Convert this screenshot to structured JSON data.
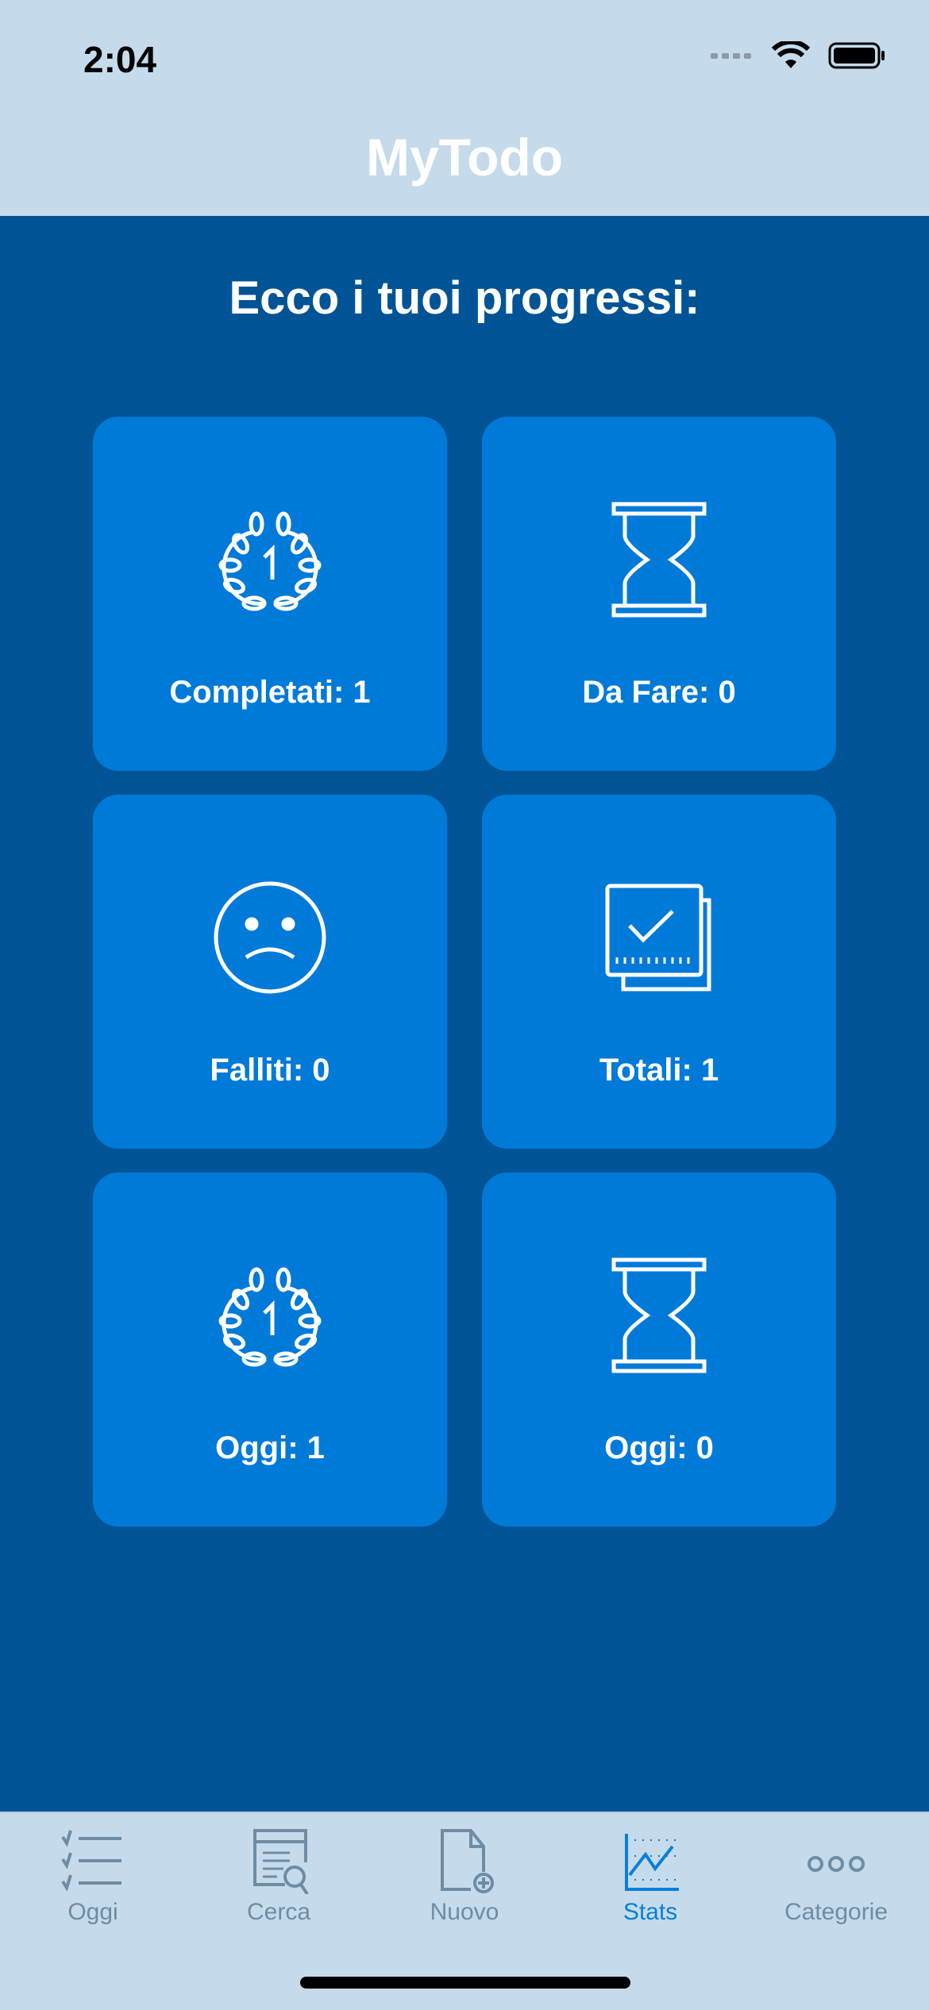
{
  "status_bar": {
    "time": "2:04"
  },
  "header": {
    "title": "MyTodo"
  },
  "main": {
    "heading": "Ecco i tuoi progressi:",
    "cards": [
      {
        "icon": "laurel-icon",
        "label": "Completati: 1"
      },
      {
        "icon": "hourglass-icon",
        "label": "Da Fare: 0"
      },
      {
        "icon": "sad-face-icon",
        "label": "Falliti: 0"
      },
      {
        "icon": "checked-docs-icon",
        "label": "Totali: 1"
      },
      {
        "icon": "laurel-icon",
        "label": "Oggi: 1"
      },
      {
        "icon": "hourglass-icon",
        "label": "Oggi: 0"
      }
    ]
  },
  "tabbar": {
    "items": [
      {
        "label": "Oggi",
        "icon": "checklist-icon"
      },
      {
        "label": "Cerca",
        "icon": "search-doc-icon"
      },
      {
        "label": "Nuovo",
        "icon": "new-doc-icon"
      },
      {
        "label": "Stats",
        "icon": "chart-icon",
        "active": true
      },
      {
        "label": "Categorie",
        "icon": "more-icon"
      }
    ]
  },
  "colors": {
    "header": "#c5dbeb",
    "background": "#005495",
    "card": "#007ad8",
    "tab_active": "#0a7fd8",
    "tab_inactive": "#6e8ca4"
  }
}
